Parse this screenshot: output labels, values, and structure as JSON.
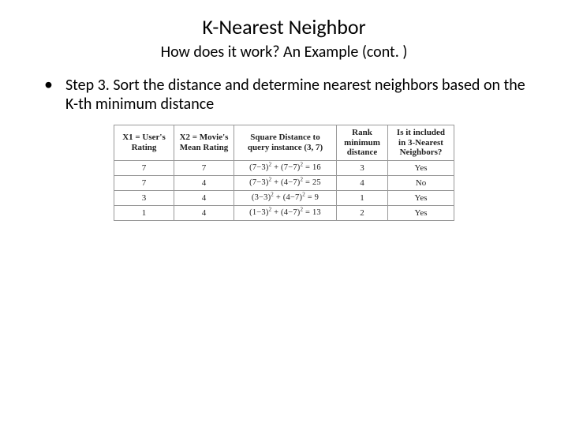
{
  "title": "K-Nearest Neighbor",
  "subtitle": "How does it work? An Example (cont. )",
  "bullet": {
    "text": " Step 3. Sort the distance and determine nearest neighbors based on the K-th minimum distance"
  },
  "table": {
    "headers": [
      "X1 = User's Rating",
      "X2 = Movie's Mean Rating",
      "Square Distance to query instance (3, 7)",
      "Rank minimum distance",
      "Is it included in 3-Nearest Neighbors?"
    ],
    "rows": [
      {
        "x1": "7",
        "x2": "7",
        "dist_html": "(7−3)<sup>2</sup> + (7−7)<sup>2</sup> = 16",
        "rank": "3",
        "inc": "Yes"
      },
      {
        "x1": "7",
        "x2": "4",
        "dist_html": "(7−3)<sup>2</sup> + (4−7)<sup>2</sup> = 25",
        "rank": "4",
        "inc": "No"
      },
      {
        "x1": "3",
        "x2": "4",
        "dist_html": "(3−3)<sup>2</sup> + (4−7)<sup>2</sup> = 9",
        "rank": "1",
        "inc": "Yes"
      },
      {
        "x1": "1",
        "x2": "4",
        "dist_html": "(1−3)<sup>2</sup> + (4−7)<sup>2</sup> = 13",
        "rank": "2",
        "inc": "Yes"
      }
    ]
  }
}
